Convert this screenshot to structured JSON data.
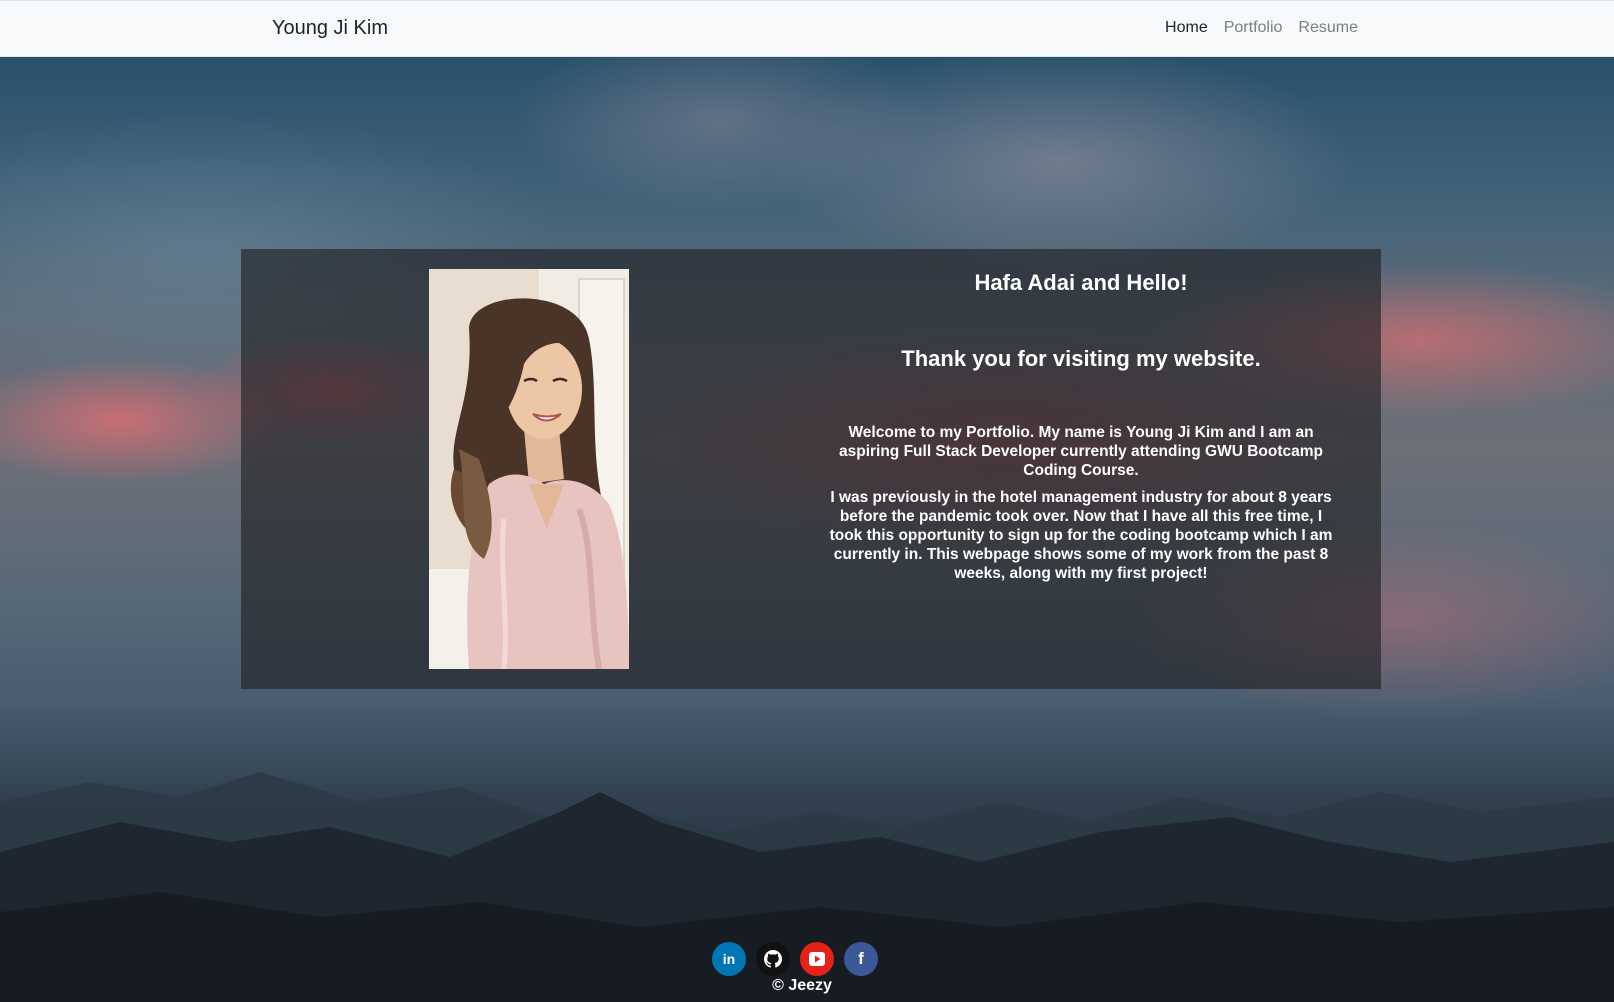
{
  "navbar": {
    "brand": "Young Ji Kim",
    "links": [
      {
        "label": "Home",
        "active": true
      },
      {
        "label": "Portfolio",
        "active": false
      },
      {
        "label": "Resume",
        "active": false
      }
    ]
  },
  "intro": {
    "greeting": "Hafa Adai and Hello!",
    "thanks": "Thank you for visiting my website.",
    "paragraph1": "Welcome to my Portfolio. My name is Young Ji Kim and I am an aspiring Full Stack Developer currently attending GWU Bootcamp Coding Course.",
    "paragraph2": "I was previously in the hotel management industry for about 8 years before the pandemic took over. Now that I have all this free time, I took this opportunity to sign up for the coding bootcamp which I am currently in. This webpage shows some of my work from the past 8 weeks, along with my first project!"
  },
  "footer": {
    "socials": [
      {
        "name": "linkedin-icon",
        "glyph": "in",
        "color": "#0077b5"
      },
      {
        "name": "github-icon",
        "glyph": "",
        "color": "#111111"
      },
      {
        "name": "youtube-icon",
        "glyph": "",
        "color": "#e62117"
      },
      {
        "name": "facebook-icon",
        "glyph": "f",
        "color": "#3b5998"
      }
    ],
    "copyright": "© Jeezy"
  }
}
